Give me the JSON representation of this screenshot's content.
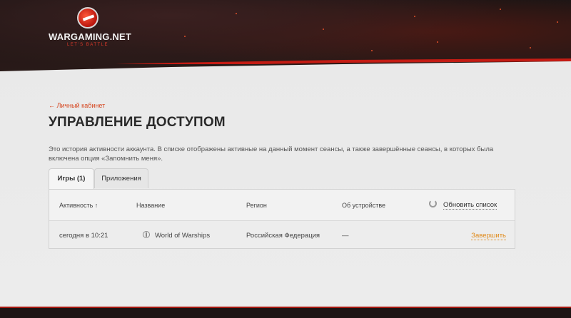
{
  "brand": {
    "name": "WARGAMING.NET",
    "tagline": "LET'S BATTLE"
  },
  "breadcrumb": "← Личный кабинет",
  "page_title": "УПРАВЛЕНИЕ ДОСТУПОМ",
  "description": "Это история активности аккаунта. В списке отображены активные на данный момент сеансы, а также завершённые сеансы, в которых была включена опция «Запомнить меня».",
  "tabs": [
    {
      "label": "Игры (1)",
      "active": true
    },
    {
      "label": "Приложения",
      "active": false
    }
  ],
  "table": {
    "headers": {
      "activity": "Активность ↑",
      "name": "Название",
      "region": "Регион",
      "device": "Об устройстве"
    },
    "refresh_label": "Обновить список",
    "rows": [
      {
        "activity": "сегодня в 10:21",
        "name": "World of Warships",
        "region": "Российская Федерация",
        "device": "—",
        "action": "Завершить"
      }
    ]
  },
  "colors": {
    "accent": "#d6451e",
    "action": "#e08a1a",
    "brand_red": "#c41c14"
  },
  "icons": {
    "logo": "wargaming-logo-icon",
    "refresh": "refresh-icon",
    "game": "warships-anchor-icon"
  }
}
